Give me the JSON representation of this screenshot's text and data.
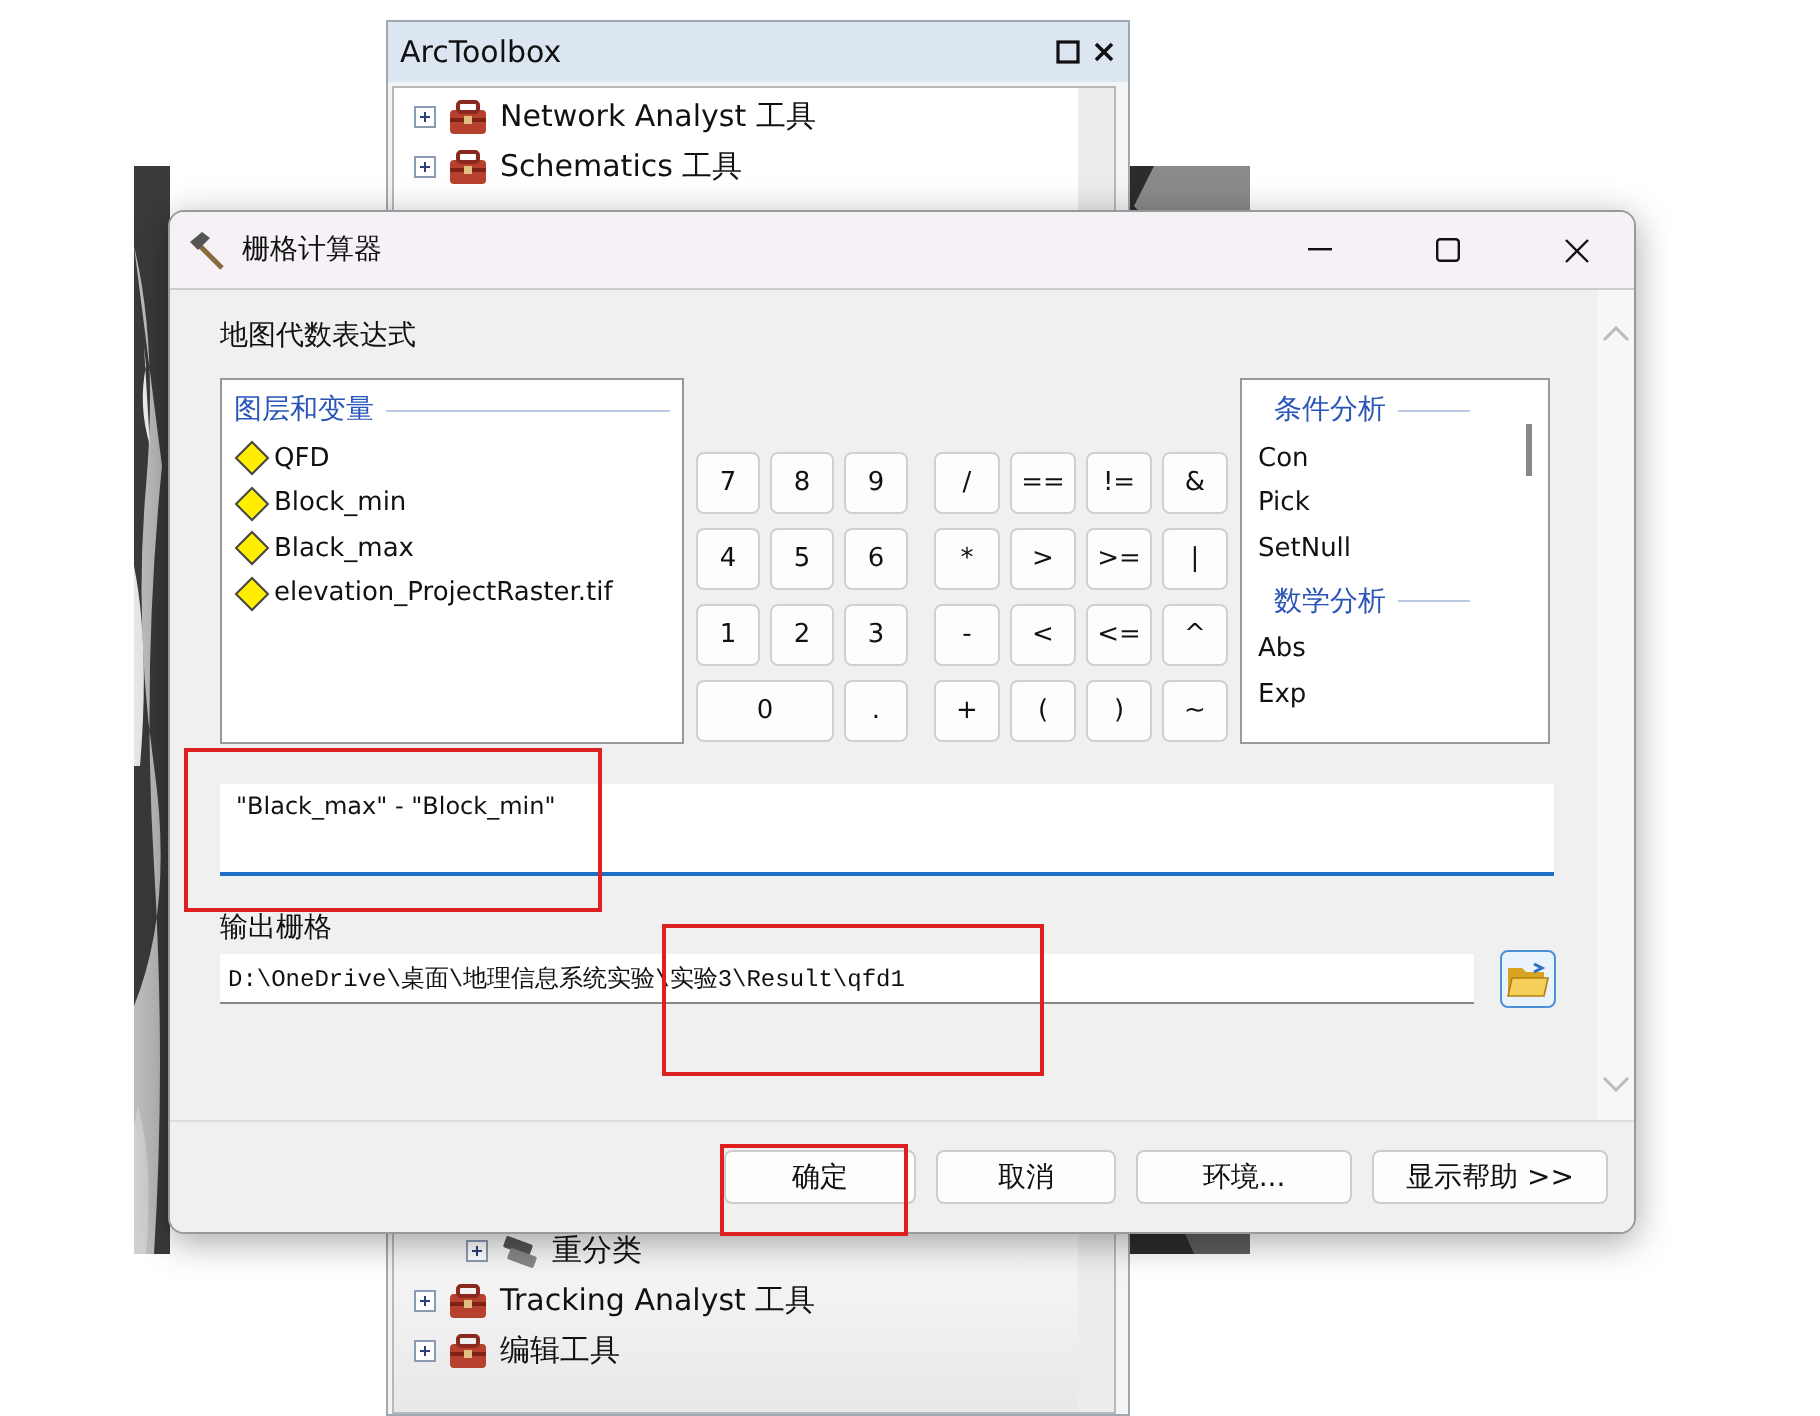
{
  "toolbox": {
    "title": "ArcToolbox",
    "items_top": [
      {
        "label": "Network Analyst 工具",
        "kind": "toolbox",
        "expanded": false
      },
      {
        "label": "Schematics 工具",
        "kind": "toolbox",
        "expanded": false
      }
    ],
    "items_bottom": [
      {
        "label": "重分类",
        "kind": "toolset",
        "expanded": false
      },
      {
        "label": "Tracking Analyst 工具",
        "kind": "toolbox",
        "expanded": false
      },
      {
        "label": "编辑工具",
        "kind": "toolbox",
        "expanded": false
      }
    ]
  },
  "dialog": {
    "title": "栅格计算器",
    "expression_label": "地图代数表达式",
    "layers": {
      "heading": "图层和变量",
      "items": [
        "QFD",
        "Block_min",
        "Black_max",
        "elevation_ProjectRaster.tif"
      ]
    },
    "digit_keys": [
      {
        "label": "7",
        "kind": "normal"
      },
      {
        "label": "8",
        "kind": "normal"
      },
      {
        "label": "9",
        "kind": "normal"
      },
      {
        "label": "4",
        "kind": "normal"
      },
      {
        "label": "5",
        "kind": "normal"
      },
      {
        "label": "6",
        "kind": "normal"
      },
      {
        "label": "1",
        "kind": "normal"
      },
      {
        "label": "2",
        "kind": "normal"
      },
      {
        "label": "3",
        "kind": "normal"
      },
      {
        "label": "0",
        "kind": "wide"
      },
      {
        "label": ".",
        "kind": "normal"
      }
    ],
    "operator_keys": [
      "/",
      "==",
      "!=",
      "&",
      "*",
      ">",
      ">=",
      "|",
      "-",
      "<",
      "<=",
      "^",
      "+",
      "(",
      ")",
      "~"
    ],
    "functions": [
      {
        "heading": "条件分析",
        "items": [
          "Con",
          "Pick",
          "SetNull"
        ]
      },
      {
        "heading": "数学分析",
        "items": [
          "Abs",
          "Exp"
        ]
      }
    ],
    "expression": "\"Black_max\" - \"Block_min\"",
    "output_label": "输出栅格",
    "output_value": "D:\\OneDrive\\桌面\\地理信息系统实验\\实验3\\Result\\qfd1",
    "buttons": [
      "确定",
      "取消",
      "环境...",
      "显示帮助 >>"
    ]
  }
}
